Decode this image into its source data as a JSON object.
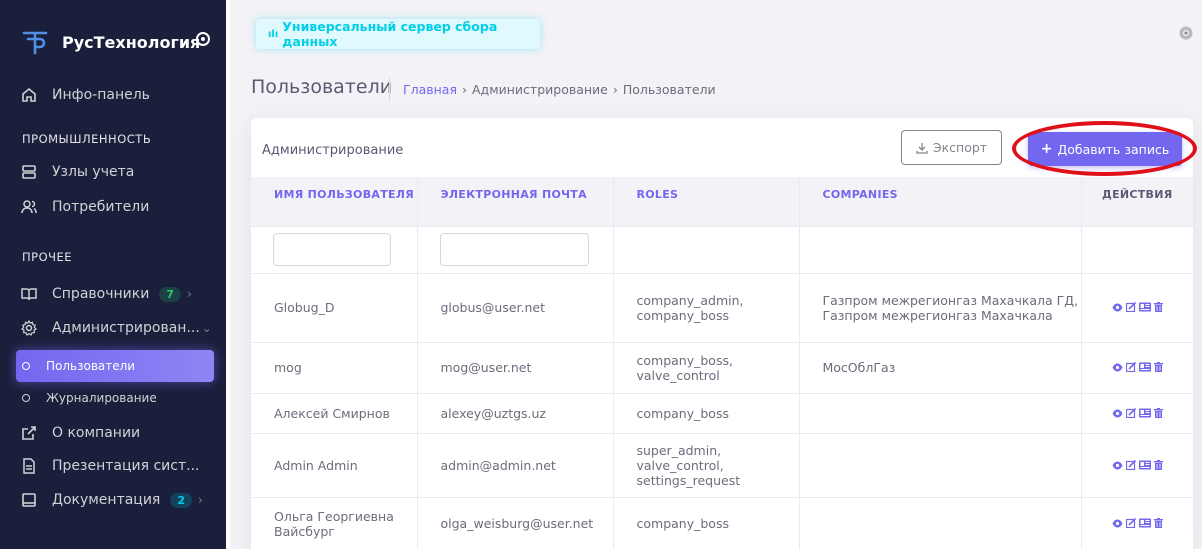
{
  "sidebar": {
    "brand": "РусТехнология",
    "items": [
      {
        "label": "Инфо-панель"
      },
      {
        "section": "ПРОМЫШЛЕННОСТЬ"
      },
      {
        "label": "Узлы учета"
      },
      {
        "label": "Потребители"
      },
      {
        "section": "ПРОЧЕЕ"
      },
      {
        "label": "Справочники",
        "badge": "7"
      },
      {
        "label": "Администрирован..."
      },
      {
        "label": "Пользователи",
        "active": true
      },
      {
        "label": "Журналирование"
      },
      {
        "label": "О компании"
      },
      {
        "label": "Презентация сист..."
      },
      {
        "label": "Документация",
        "badge": "2"
      }
    ]
  },
  "topbar": {
    "chip": "Универсальный сервер сбора данных"
  },
  "header": {
    "title": "Пользователи",
    "breadcrumb": [
      "Главная",
      "Администрирование",
      "Пользователи"
    ]
  },
  "card": {
    "title": "Администрирование",
    "export_label": "Экспорт",
    "add_label": "Добавить запись"
  },
  "table": {
    "columns": [
      "ИМЯ ПОЛЬЗОВАТЕЛЯ",
      "ЭЛЕКТРОННАЯ ПОЧТА",
      "ROLES",
      "COMPANIES",
      "ДЕЙСТВИЯ"
    ],
    "rows": [
      {
        "name": "Globug_D",
        "email": "globus@user.net",
        "roles": "company_admin, company_boss",
        "companies": "Газпром межрегионгаз Махачкала ГД, Газпром межрегионгаз Махачкала"
      },
      {
        "name": "mog",
        "email": "mog@user.net",
        "roles": "company_boss, valve_control",
        "companies": "МосОблГаз"
      },
      {
        "name": "Алексей Смирнов",
        "email": "alexey@uztgs.uz",
        "roles": "company_boss",
        "companies": ""
      },
      {
        "name": "Admin Admin",
        "email": "admin@admin.net",
        "roles": "super_admin, valve_control, settings_request",
        "companies": ""
      },
      {
        "name": "Ольга Георгиевна Вайсбург",
        "email": "olga_weisburg@user.net",
        "roles": "company_boss",
        "companies": ""
      }
    ]
  },
  "colors": {
    "accent": "#7367f0",
    "sidebar_bg": "#1a1f3b",
    "highlight": "#e0101a"
  }
}
